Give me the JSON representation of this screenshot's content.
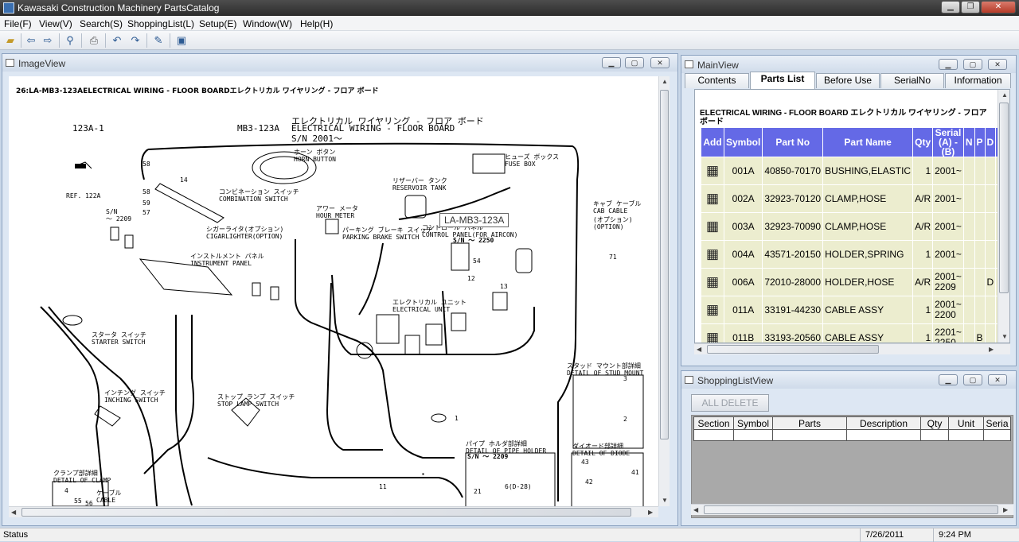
{
  "app": {
    "title": "Kawasaki Construction Machinery PartsCatalog"
  },
  "menu": [
    "File(F)",
    "View(V)",
    "Search(S)",
    "ShoppingList(L)",
    "Setup(E)",
    "Window(W)",
    "Help(H)"
  ],
  "image_view": {
    "title": "ImageView",
    "header": "26:LA-MB3-123AELECTRICAL WIRING - FLOOR BOARDエレクトリカル ワイヤリング - フロア ボード",
    "callout": "LA-MB3-123A",
    "diagram": {
      "page_id": "123A-1",
      "code": "MB3-123A",
      "title_jp": "エレクトリカル ワイヤリング - フロア ボード",
      "title_en": "ELECTRICAL WIRING - FLOOR BOARD",
      "serial": "S/N 2001～",
      "labels": [
        {
          "text": "REF. 122A"
        },
        {
          "text": "S/N\n～ 2209"
        },
        {
          "text": "58"
        },
        {
          "text": "14"
        },
        {
          "text": "58"
        },
        {
          "text": "59"
        },
        {
          "text": "57"
        },
        {
          "text": "ホーン ボタン\nHORN BUTTON"
        },
        {
          "text": "コンビネーション スイッチ\nCOMBINATION SWITCH"
        },
        {
          "text": "アワー メータ\nHOUR METER"
        },
        {
          "text": "リザーバー タンク\nRESERVOIR TANK"
        },
        {
          "text": "ヒューズ ボックス\nFUSE BOX"
        },
        {
          "text": "シガーライタ(オプション)\nCIGARLIGHTER(OPTION)"
        },
        {
          "text": "パーキング ブレーキ スイッチ\nPARKING BRAKE SWITCH"
        },
        {
          "text": "コントロール パネル\nCONTROL PANEL(FOR AIRCON)"
        },
        {
          "text": "キャブ ケーブル\nCAB CABLE"
        },
        {
          "text": "(オプション)\n(OPTION)"
        },
        {
          "text": "インストルメント パネル\nINSTRUMENT PANEL"
        },
        {
          "text": "S/N ～ 2250"
        },
        {
          "text": "54"
        },
        {
          "text": "12"
        },
        {
          "text": "13"
        },
        {
          "text": "71"
        },
        {
          "text": "エレクトリカル ユニット\nELECTRICAL UNIT"
        },
        {
          "text": "スタータ スイッチ\nSTARTER SWITCH"
        },
        {
          "text": "インチング スイッチ\nINCHING SWITCH"
        },
        {
          "text": "ストップ ランプ スイッチ\nSTOP LAMP SWITCH"
        },
        {
          "text": "スタッド マウント部詳細\nDETAIL OF STUD MOUNT"
        },
        {
          "text": "3"
        },
        {
          "text": "2"
        },
        {
          "text": "1"
        },
        {
          "text": "パイプ ホルダ部詳細\nDETAIL OF PIPE HOLDER"
        },
        {
          "text": "S/N ～ 2209"
        },
        {
          "text": "6(D-28)"
        },
        {
          "text": "21"
        },
        {
          "text": "ダイオード部詳細\nDETAIL OF DIODE"
        },
        {
          "text": "43"
        },
        {
          "text": "41"
        },
        {
          "text": "42"
        },
        {
          "text": "クランプ部詳細\nDETAIL OF CLAMP"
        },
        {
          "text": "4"
        },
        {
          "text": "55"
        },
        {
          "text": "56"
        },
        {
          "text": "ケーブル\nCABLE"
        },
        {
          "text": "11"
        }
      ]
    }
  },
  "main_view": {
    "title": "MainView",
    "tabs": [
      "Contents",
      "Parts List",
      "Before Use",
      "SerialNo",
      "Information"
    ],
    "active_tab": "Parts List",
    "parts_title": "ELECTRICAL WIRING - FLOOR BOARD エレクトリカル ワイヤリング - フロア ボード",
    "columns": [
      "Add",
      "Symbol",
      "Part No",
      "Part Name",
      "Qty",
      "Serial (A) - (B)",
      "N",
      "P",
      "D",
      "(A"
    ],
    "rows": [
      {
        "symbol": "001A",
        "part_no": "40850-70170",
        "part_name": "BUSHING,ELASTIC",
        "qty": "1",
        "serial": "2001~",
        "n": "",
        "p": "",
        "d": ""
      },
      {
        "symbol": "002A",
        "part_no": "32923-70120",
        "part_name": "CLAMP,HOSE",
        "qty": "A/R",
        "serial": "2001~",
        "n": "",
        "p": "",
        "d": ""
      },
      {
        "symbol": "003A",
        "part_no": "32923-70090",
        "part_name": "CLAMP,HOSE",
        "qty": "A/R",
        "serial": "2001~",
        "n": "",
        "p": "",
        "d": ""
      },
      {
        "symbol": "004A",
        "part_no": "43571-20150",
        "part_name": "HOLDER,SPRING",
        "qty": "1",
        "serial": "2001~",
        "n": "",
        "p": "",
        "d": ""
      },
      {
        "symbol": "006A",
        "part_no": "72010-28000",
        "part_name": "HOLDER,HOSE",
        "qty": "A/R",
        "serial": "2001~\n2209",
        "n": "",
        "p": "",
        "d": "D"
      },
      {
        "symbol": "011A",
        "part_no": "33191-44230",
        "part_name": "CABLE ASSY",
        "qty": "1",
        "serial": "2001~\n2200",
        "n": "",
        "p": "",
        "d": ""
      },
      {
        "symbol": "011B",
        "part_no": "33193-20560",
        "part_name": "CABLE ASSY",
        "qty": "1",
        "serial": "2201~\n2250",
        "n": "",
        "p": "B",
        "d": ""
      }
    ]
  },
  "shopping_view": {
    "title": "ShoppingListView",
    "all_delete": "ALL DELETE",
    "columns": [
      "Section",
      "Symbol",
      "Parts",
      "Description",
      "Qty",
      "Unit",
      "Seria"
    ]
  },
  "status": {
    "label": "Status",
    "date": "7/26/2011",
    "time": "9:24 PM"
  },
  "colors": {
    "header_blue": "#6469e6",
    "row_beige": "#ecedcf",
    "mdi_bg": "#c9d7e8"
  },
  "icons": [
    "folder-open-icon",
    "back-arrow-icon",
    "forward-arrow-icon",
    "zoom-icon",
    "print-icon",
    "undo-icon",
    "redo-icon",
    "edit-icon",
    "window-icon",
    "cart-icon"
  ]
}
